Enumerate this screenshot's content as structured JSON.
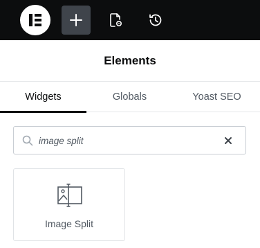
{
  "toolbar": {
    "logo_icon": "elementor-logo-icon",
    "add_icon": "plus-icon",
    "settings_icon": "page-settings-icon",
    "history_icon": "history-icon"
  },
  "panel": {
    "title": "Elements"
  },
  "tabs": [
    {
      "label": "Widgets",
      "active": true
    },
    {
      "label": "Globals",
      "active": false
    },
    {
      "label": "Yoast SEO",
      "active": false
    }
  ],
  "search": {
    "value": "image split",
    "search_icon": "search-icon",
    "clear_icon": "close-icon"
  },
  "widgets": [
    {
      "label": "Image Split",
      "icon": "image-split-icon"
    }
  ],
  "colors": {
    "topbar": "#0c0d0e",
    "active_tool": "#3f444b",
    "text_primary": "#0c0d0e",
    "text_secondary": "#515962",
    "border": "#e6e8ea"
  }
}
